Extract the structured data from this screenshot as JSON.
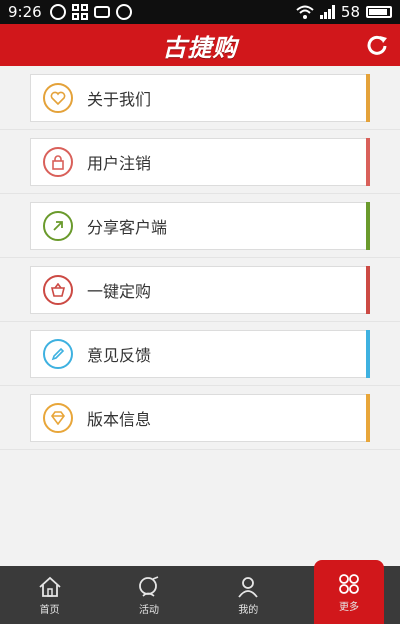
{
  "status_bar": {
    "time": "9:26",
    "battery": "58"
  },
  "header": {
    "logo_text": "古捷购"
  },
  "menu": [
    {
      "label": "关于我们",
      "icon": "heart-chat-icon",
      "color": "#e4a23a"
    },
    {
      "label": "用户注销",
      "icon": "lock-icon",
      "color": "#d9605a"
    },
    {
      "label": "分享客户端",
      "icon": "share-arrow-icon",
      "color": "#6a9a2c"
    },
    {
      "label": "一键定购",
      "icon": "basket-icon",
      "color": "#cc4a44"
    },
    {
      "label": "意见反馈",
      "icon": "pencil-icon",
      "color": "#3eb1e0"
    },
    {
      "label": "版本信息",
      "icon": "diamond-icon",
      "color": "#e8a63a"
    }
  ],
  "tabs": [
    {
      "label": "首页",
      "icon": "home-icon"
    },
    {
      "label": "活动",
      "icon": "activity-icon"
    },
    {
      "label": "我的",
      "icon": "person-icon"
    },
    {
      "label": "更多",
      "icon": "more-grid-icon"
    }
  ],
  "colors": {
    "header": "#d1171b",
    "tabbar": "#3a3a3a",
    "active_tab": "#d1171b"
  }
}
